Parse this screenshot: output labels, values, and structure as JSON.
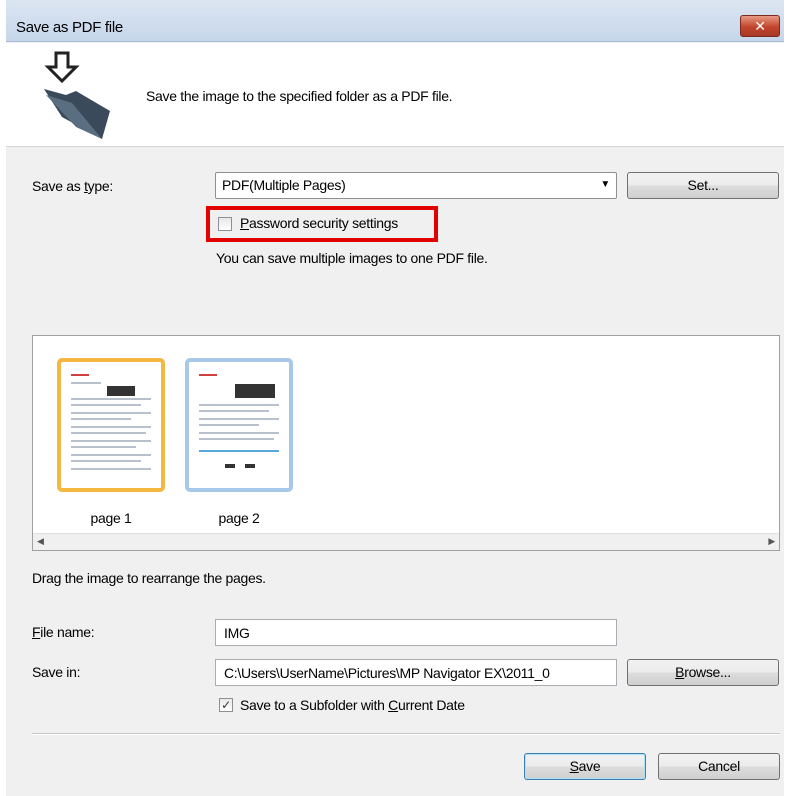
{
  "window": {
    "title": "Save as PDF file",
    "close_label": "✕"
  },
  "header": {
    "description": "Save the image to the specified folder as a PDF file."
  },
  "save_as_type": {
    "label": "Save as type:",
    "selected": "PDF(Multiple Pages)",
    "set_button": "Set..."
  },
  "password": {
    "label": "Password security settings",
    "checked": false
  },
  "info_text": "You can save multiple images to one PDF file.",
  "pages": [
    {
      "label": "page 1",
      "selected": true
    },
    {
      "label": "page 2",
      "selected": false
    }
  ],
  "drag_hint": "Drag the image to rearrange the pages.",
  "file_name": {
    "label": "File name:",
    "value": "IMG"
  },
  "save_in": {
    "label": "Save in:",
    "value": "C:\\Users\\UserName\\Pictures\\MP Navigator EX\\2011_0",
    "browse_button": "Browse..."
  },
  "subfolder": {
    "label": "Save to a Subfolder with Current Date",
    "checked": true
  },
  "footer": {
    "save_button": "Save",
    "cancel_button": "Cancel"
  },
  "colors": {
    "highlight": "#e30000",
    "selected_thumb": "#f4b740",
    "unselected_thumb": "#a8c8ea"
  }
}
